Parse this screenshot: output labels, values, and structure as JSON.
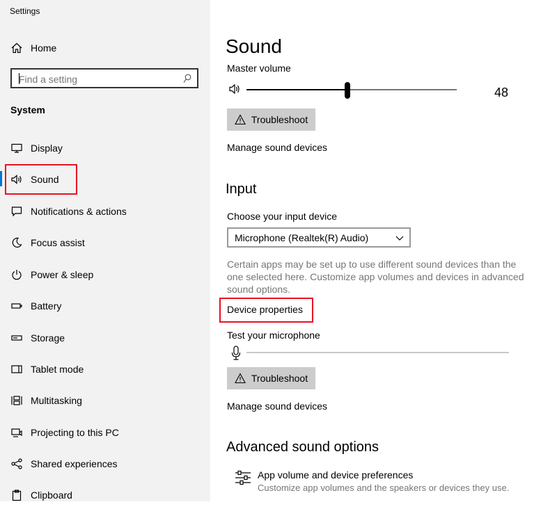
{
  "app": {
    "title": "Settings"
  },
  "sidebar": {
    "home_label": "Home",
    "search_placeholder": "Find a setting",
    "section": "System",
    "items": [
      {
        "label": "Display",
        "icon": "display-icon"
      },
      {
        "label": "Sound",
        "icon": "speaker-icon",
        "selected": true
      },
      {
        "label": "Notifications & actions",
        "icon": "notifications-icon"
      },
      {
        "label": "Focus assist",
        "icon": "moon-icon"
      },
      {
        "label": "Power & sleep",
        "icon": "power-icon"
      },
      {
        "label": "Battery",
        "icon": "battery-icon"
      },
      {
        "label": "Storage",
        "icon": "storage-icon"
      },
      {
        "label": "Tablet mode",
        "icon": "tablet-icon"
      },
      {
        "label": "Multitasking",
        "icon": "multitasking-icon"
      },
      {
        "label": "Projecting to this PC",
        "icon": "projecting-icon"
      },
      {
        "label": "Shared experiences",
        "icon": "shared-icon"
      },
      {
        "label": "Clipboard",
        "icon": "clipboard-icon"
      }
    ]
  },
  "main": {
    "title": "Sound",
    "output": {
      "master_volume_label": "Master volume",
      "volume_value": "48",
      "volume_fraction": 0.48,
      "troubleshoot_label": "Troubleshoot",
      "manage_devices_label": "Manage sound devices"
    },
    "input": {
      "heading": "Input",
      "choose_label": "Choose your input device",
      "selected_device": "Microphone (Realtek(R) Audio)",
      "info_text": "Certain apps may be set up to use different sound devices than the one selected here. Customize app volumes and devices in advanced sound options.",
      "device_properties_label": "Device properties",
      "test_mic_label": "Test your microphone",
      "mic_level_fraction": 0,
      "troubleshoot_label": "Troubleshoot",
      "manage_devices_label": "Manage sound devices"
    },
    "advanced": {
      "heading": "Advanced sound options",
      "item_title": "App volume and device preferences",
      "item_desc": "Customize app volumes and the speakers or devices they use."
    }
  },
  "colors": {
    "sidebar_bg": "#f2f2f2",
    "accent": "#0078d7",
    "highlight": "#e81123",
    "button_bg": "#cccccc"
  }
}
